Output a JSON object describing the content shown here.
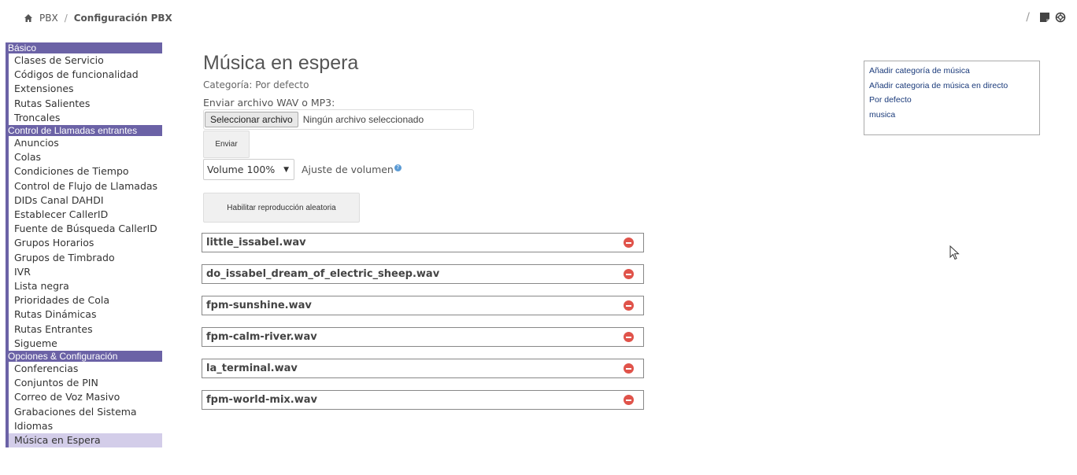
{
  "breadcrumb": {
    "items": [
      "PBX",
      "Configuración PBX"
    ]
  },
  "sidebar": {
    "sections": [
      {
        "header": "Básico",
        "items": [
          "Clases de Servicio",
          "Códigos de funcionalidad",
          "Extensiones",
          "Rutas Salientes",
          "Troncales"
        ]
      },
      {
        "header": "Control de Llamadas entrantes",
        "items": [
          "Anuncios",
          "Colas",
          "Condiciones de Tiempo",
          "Control de Flujo de Llamadas",
          "DIDs Canal DAHDI",
          "Establecer CallerID",
          "Fuente de Búsqueda CallerID",
          "Grupos Horarios",
          "Grupos de Timbrado",
          "IVR",
          "Lista negra",
          "Prioridades de Cola",
          "Rutas Dinámicas",
          "Rutas Entrantes",
          "Sigueme"
        ]
      },
      {
        "header": "Opciones & Configuración",
        "items": [
          "Conferencias",
          "Conjuntos de PIN",
          "Correo de Voz Masivo",
          "Grabaciones del Sistema",
          "Idiomas",
          "Música en Espera"
        ]
      }
    ],
    "active_item": "Música en Espera"
  },
  "main": {
    "title": "Música en espera",
    "category": "Categoría: Por defecto",
    "upload_label": "Enviar archivo WAV o MP3:",
    "file_button": "Seleccionar archivo",
    "file_status": "Ningún archivo seleccionado",
    "send_button": "Enviar",
    "volume_value": "Volume 100%",
    "volume_label": "Ajuste de volumen",
    "shuffle_button": "Habilitar reproducción aleatoria",
    "files": [
      "little_issabel.wav",
      "do_issabel_dream_of_electric_sheep.wav",
      "fpm-sunshine.wav",
      "fpm-calm-river.wav",
      "la_terminal.wav",
      "fpm-world-mix.wav"
    ]
  },
  "right_panel": {
    "links": [
      "Añadir categoría de música",
      "Añadir categoria de música en directo",
      "Por defecto",
      "musica"
    ]
  },
  "colors": {
    "accent": "#6b62a6",
    "active_bg": "#d3cde9",
    "delete": "#e0534a"
  }
}
